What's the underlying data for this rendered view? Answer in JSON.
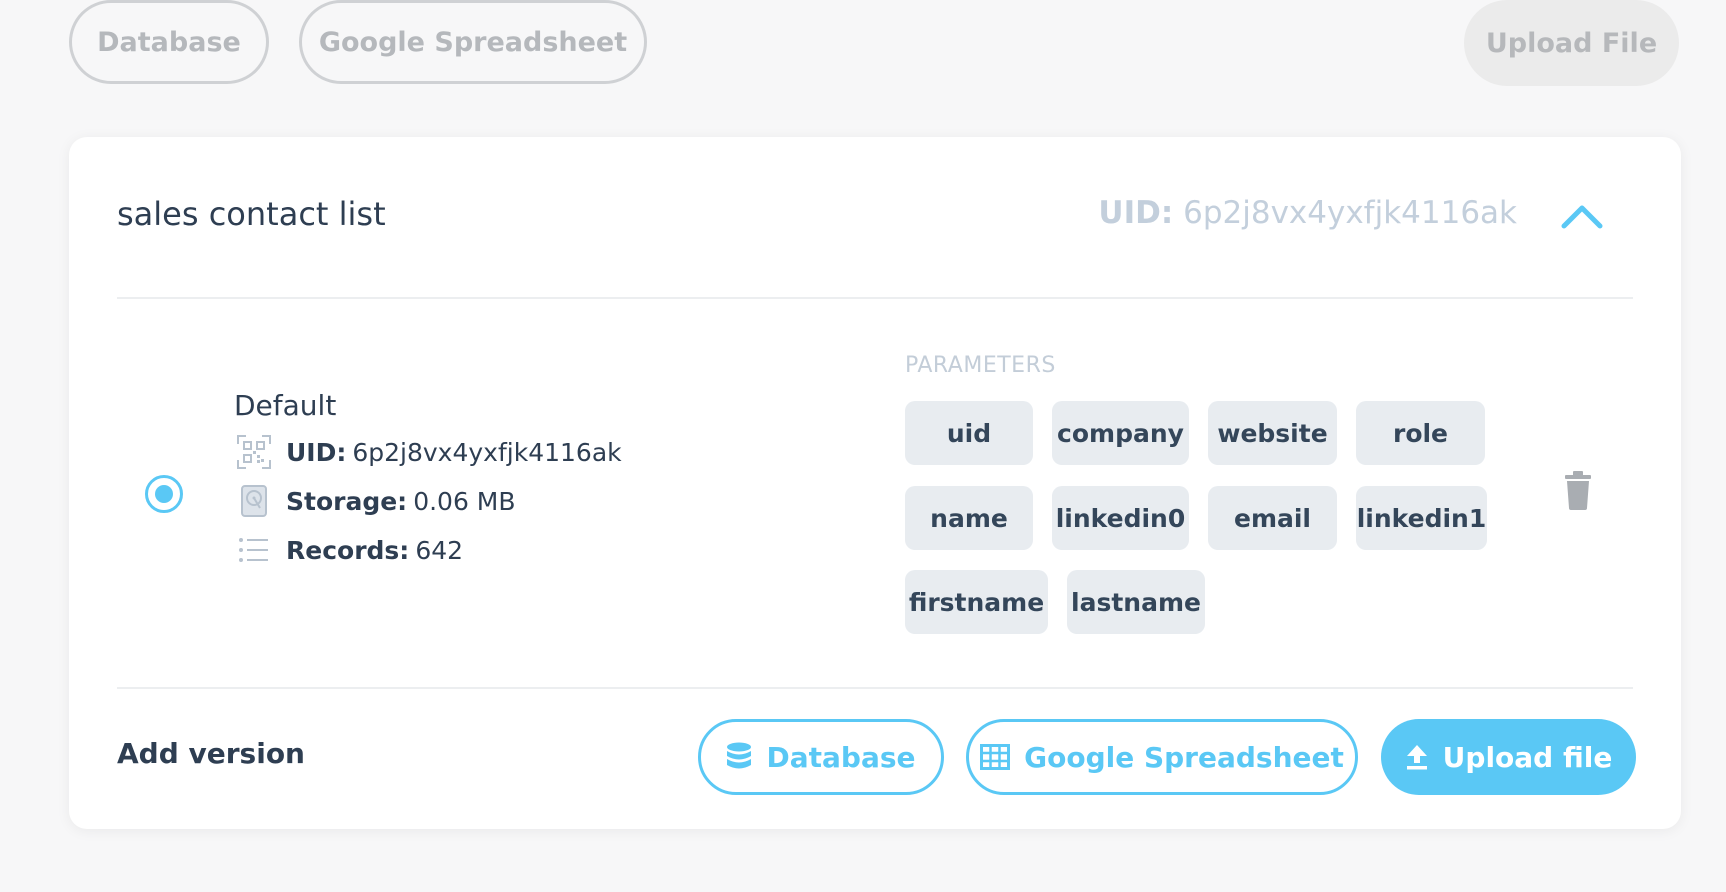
{
  "top_bar": {
    "database_label": "Database",
    "spreadsheet_label": "Google Spreadsheet",
    "upload_label": "Upload File"
  },
  "card": {
    "title": "sales contact list",
    "uid_label": "UID:",
    "uid_value": "6p2j8vx4yxfjk4116ak",
    "collapse_icon": "chevron-up-icon"
  },
  "version": {
    "name": "Default",
    "uid_label": "UID:",
    "uid_value": "6p2j8vx4yxfjk4116ak",
    "storage_label": "Storage:",
    "storage_value": "0.06 MB",
    "records_label": "Records:",
    "records_value": "642",
    "selected": true
  },
  "parameters": {
    "heading": "PARAMETERS",
    "items": [
      "uid",
      "company",
      "website",
      "role",
      "name",
      "linkedin0",
      "email",
      "linkedin1",
      "firstname",
      "lastname"
    ]
  },
  "footer": {
    "add_version_label": "Add version",
    "database_label": "Database",
    "spreadsheet_label": "Google Spreadsheet",
    "upload_label": "Upload file"
  },
  "colors": {
    "accent": "#5ac8f5",
    "text": "#2e3e52",
    "muted": "#c3cfdc",
    "chip_bg": "#e8ecf0"
  }
}
